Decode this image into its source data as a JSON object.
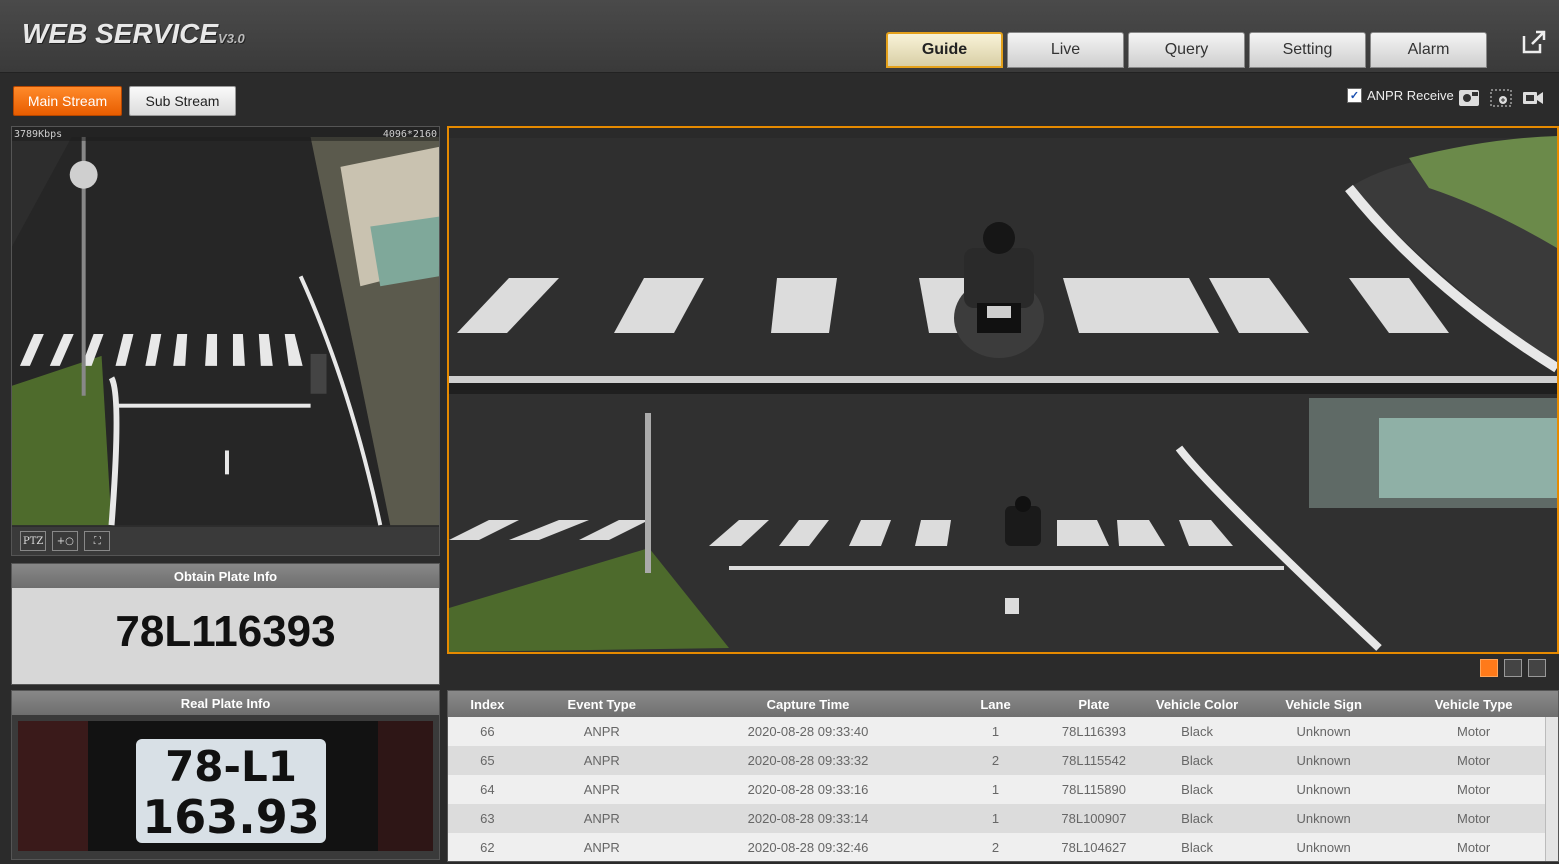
{
  "app": {
    "logo": "WEB  SERVICE",
    "version": "V3.0"
  },
  "tabs": [
    {
      "label": "Guide",
      "active": true
    },
    {
      "label": "Live",
      "active": false
    },
    {
      "label": "Query",
      "active": false
    },
    {
      "label": "Setting",
      "active": false
    },
    {
      "label": "Alarm",
      "active": false
    }
  ],
  "stream": {
    "main_label": "Main Stream",
    "sub_label": "Sub Stream"
  },
  "anpr": {
    "label": "ANPR Receive",
    "checked": true
  },
  "left_video": {
    "bitrate": "3789Kbps",
    "resolution": "4096*2160",
    "ptz_label": "PTZ"
  },
  "obtain_plate": {
    "title": "Obtain Plate Info",
    "plate": "78L116393"
  },
  "real_plate": {
    "title": "Real Plate Info",
    "line1": "78-L1",
    "line2": "163.93"
  },
  "colors": {
    "accent": "#e68a00",
    "button_orange": "#ff7a1a",
    "header_bg": "#3f3f3f"
  },
  "table": {
    "columns": [
      "Index",
      "Event Type",
      "Capture Time",
      "Lane",
      "Plate",
      "Vehicle Color",
      "Vehicle Sign",
      "Vehicle Type"
    ],
    "rows": [
      [
        "66",
        "ANPR",
        "2020-08-28 09:33:40",
        "1",
        "78L116393",
        "Black",
        "Unknown",
        "Motor"
      ],
      [
        "65",
        "ANPR",
        "2020-08-28 09:33:32",
        "2",
        "78L115542",
        "Black",
        "Unknown",
        "Motor"
      ],
      [
        "64",
        "ANPR",
        "2020-08-28 09:33:16",
        "1",
        "78L115890",
        "Black",
        "Unknown",
        "Motor"
      ],
      [
        "63",
        "ANPR",
        "2020-08-28 09:33:14",
        "1",
        "78L100907",
        "Black",
        "Unknown",
        "Motor"
      ],
      [
        "62",
        "ANPR",
        "2020-08-28 09:32:46",
        "2",
        "78L104627",
        "Black",
        "Unknown",
        "Motor"
      ]
    ]
  }
}
